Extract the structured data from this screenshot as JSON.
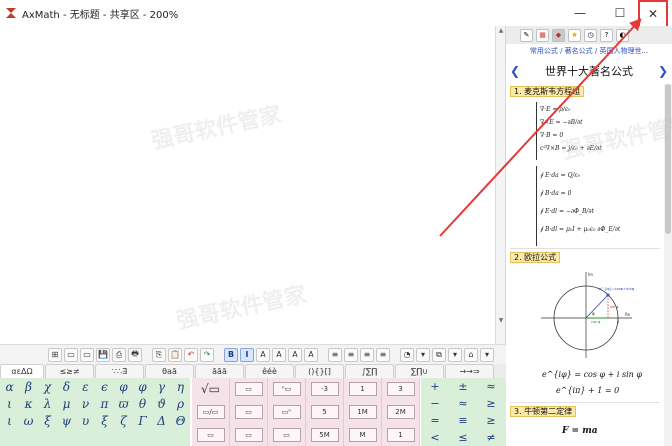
{
  "window": {
    "title": "AxMath - 无标题 - 共享区 - 200%",
    "minimize_glyph": "—",
    "maximize_glyph": "☐",
    "close_glyph": "✕"
  },
  "toolbar": {
    "buttons": [
      "⊞",
      "▭",
      "▭",
      "💾",
      "⎙",
      "🖶",
      "⎘",
      "📋",
      "↶",
      "↷",
      "B",
      "I",
      "A",
      "A",
      "A",
      "A",
      "≡",
      "≡",
      "≡",
      "≡",
      "◔",
      "▾",
      "⧉",
      "▾",
      "⌂",
      "▾"
    ]
  },
  "symbol_tabs": [
    "αεΔΩ",
    "≤≥≠",
    "∵∴∃",
    "θaā",
    "āāā",
    "êéè",
    "(){}[]",
    "∫∑∏",
    "∑∏∪",
    "→→⇒"
  ],
  "greek_symbols": [
    "α",
    "β",
    "χ",
    "δ",
    "ε",
    "ϵ",
    "φ",
    "φ",
    "γ",
    "η",
    "ι",
    "κ",
    "λ",
    "μ",
    "ν",
    "π",
    "ϖ",
    "θ",
    "ϑ",
    "ρ",
    "ι",
    "ω",
    "ξ",
    "ψ",
    "υ",
    "ξ",
    "ζ",
    "Γ",
    "Δ",
    "Θ"
  ],
  "templates": {
    "columns": [
      [
        "√▭",
        "▭/▭",
        "▭"
      ],
      [
        "▭",
        "▭",
        "▭"
      ],
      [
        "ⁿ▭",
        "▭ⁿ",
        "▭"
      ],
      [
        "-3",
        "5",
        "5M"
      ],
      [
        "1",
        "1M",
        "M"
      ],
      [
        "3",
        "2M",
        "1"
      ]
    ]
  },
  "relations": [
    "+",
    "±",
    "≈",
    "−",
    "≈",
    "≥",
    "=",
    "≡",
    "≥",
    "<",
    "≤",
    "≠"
  ],
  "side_panel": {
    "breadcrumb": "常用公式 / 著名公式 / 英国人物理世...",
    "title": "世界十大著名公式",
    "prev_glyph": "❮",
    "next_glyph": "❯",
    "sections": [
      {
        "label": "1. 麦克斯韦方程组"
      },
      {
        "label": "2. 欧拉公式"
      },
      {
        "label": "3. 牛顿第二定律"
      }
    ],
    "maxwell_lines": [
      "∇·E = ρ/ε₀",
      "∇×E = −∂B/∂t",
      "∇·B = 0",
      "c²∇×B = j/ε₀ + ∂E/∂t",
      "∮ E·da = Q/ε₀",
      "∮ B·da = 0",
      "∮ E·dl = −∂Φ_B/∂t",
      "∮ B·dl = μ₀I + μ₀ε₀ ∂Φ_E/∂t"
    ],
    "euler_lines": [
      "e^{iφ} = cos φ + i sin φ",
      "e^{iπ} + 1 = 0"
    ],
    "newton_line": "F = ma",
    "unit_circle_labels": [
      "Im",
      "Re",
      "e^{iφ}=cosφ+isinφ",
      "φ",
      "cos φ",
      "sin φ",
      "1"
    ]
  },
  "watermark_text": "强哥软件管家",
  "colors": {
    "accent_close": "#e53935",
    "greek_bg": "#d9efd9",
    "template_bg": "#f6e3ea",
    "section_bg": "#fbe9a8"
  }
}
